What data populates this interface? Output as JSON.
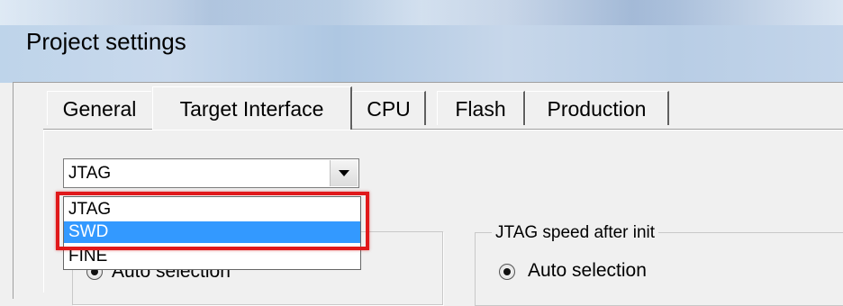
{
  "window": {
    "title": "Project settings"
  },
  "tabs": [
    {
      "label": "General"
    },
    {
      "label": "Target Interface",
      "active": true
    },
    {
      "label": "CPU"
    },
    {
      "label": "Flash"
    },
    {
      "label": "Production"
    }
  ],
  "interface_select": {
    "selected": "JTAG",
    "options": [
      "JTAG",
      "SWD",
      "FINE"
    ],
    "highlighted": "SWD"
  },
  "left_group": {
    "radio_label": "Auto selection"
  },
  "right_group": {
    "title": "JTAG speed after init",
    "radio_label": "Auto selection"
  },
  "colors": {
    "highlight_border": "#e0191b",
    "selected_option_bg": "#3399ff"
  }
}
